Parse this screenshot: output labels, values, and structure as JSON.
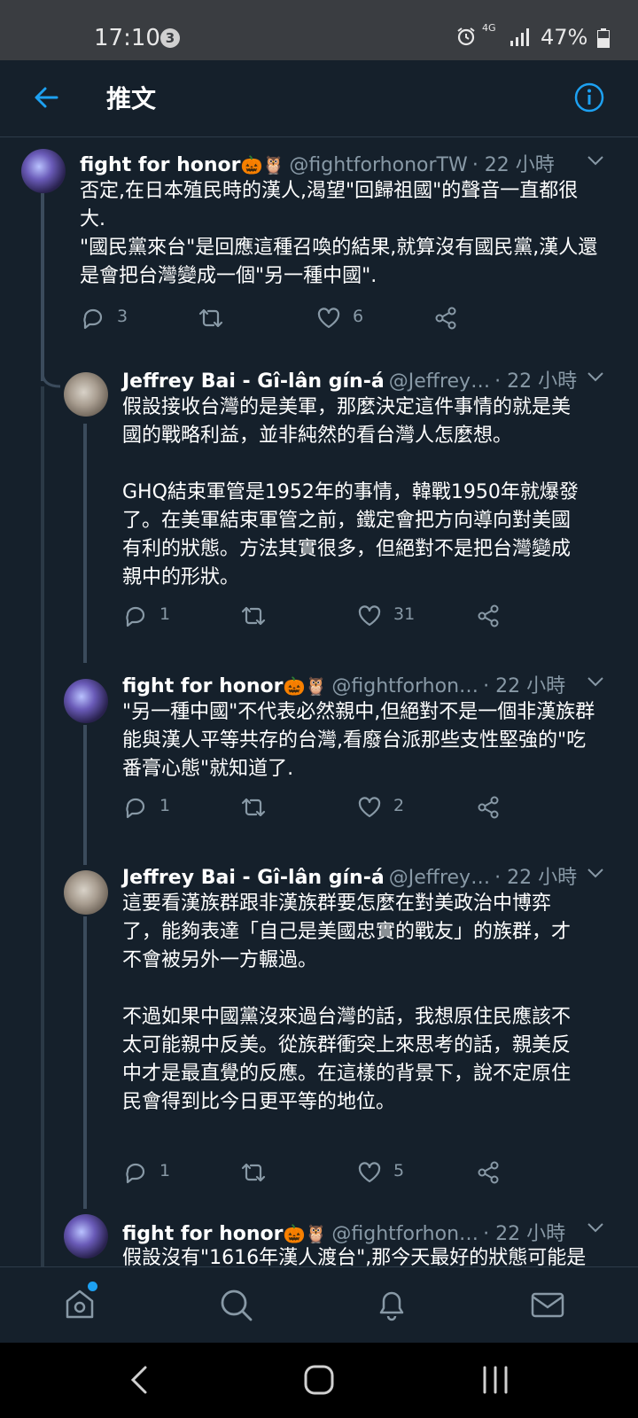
{
  "status_bar": {
    "time": "17:10",
    "notification_count": "3",
    "network": "4G",
    "battery": "47%"
  },
  "header": {
    "title": "推文",
    "back_icon": "arrow-left-icon",
    "info_icon": "info-icon"
  },
  "tweets": [
    {
      "name": "fight for honor",
      "emojis": "🎃🦉",
      "handle": "@fightforhonorTW",
      "time": "· 22 小時",
      "text": "否定,在日本殖民時的漢人,渴望\"回歸祖國\"的聲音一直都很\n大.\n\"國民黨來台\"是回應這種召喚的結果,就算沒有國民黨,漢人還\n是會把台灣變成一個\"另一種中國\".",
      "replies": "3",
      "retweets": "",
      "likes": "6"
    },
    {
      "name": "Jeffrey Bai - Gî-lân gín-á",
      "emojis": "",
      "handle": "@Jeffrey…",
      "time": "· 22 小時",
      "text": "假設接收台灣的是美軍，那麼決定這件事情的就是美\n國的戰略利益，並非純然的看台灣人怎麼想。\n\nGHQ結束軍管是1952年的事情，韓戰1950年就爆發\n了。在美軍結束軍管之前，鐵定會把方向導向對美國\n有利的狀態。方法其實很多，但絕對不是把台灣變成\n親中的形狀。",
      "replies": "1",
      "retweets": "",
      "likes": "31"
    },
    {
      "name": "fight for honor",
      "emojis": "🎃🦉",
      "handle": "@fightforhon…",
      "time": "· 22 小時",
      "text": "\"另一種中國\"不代表必然親中,但絕對不是一個非漢族群\n能與漢人平等共存的台灣,看廢台派那些支性堅強的\"吃\n番膏心態\"就知道了.",
      "replies": "1",
      "retweets": "",
      "likes": "2"
    },
    {
      "name": "Jeffrey Bai - Gî-lân gín-á",
      "emojis": "",
      "handle": "@Jeffrey…",
      "time": "· 22 小時",
      "text": "這要看漢族群跟非漢族群要怎麼在對美政治中博弈\n了，能夠表達「自己是美國忠實的戰友」的族群，才\n不會被另外一方輾過。\n\n不過如果中國黨沒來過台灣的話，我想原住民應該不\n太可能親中反美。從族群衝突上來思考的話，親美反\n中才是最直覺的反應。在這樣的背景下，說不定原住\n民會得到比今日更平等的地位。",
      "replies": "1",
      "retweets": "",
      "likes": "5"
    },
    {
      "name": "fight for honor",
      "emojis": "🎃🦉",
      "handle": "@fightforhon…",
      "time": "· 22 小時",
      "text": "假設沒有\"1616年漢人渡台\",那今天最好的狀態可能是"
    }
  ],
  "bottom_nav": {
    "items": [
      "home-icon",
      "search-icon",
      "bell-icon",
      "mail-icon"
    ]
  },
  "system_nav": {
    "items": [
      "back-chevron-icon",
      "home-circle-icon",
      "recents-icon"
    ]
  },
  "colors": {
    "background": "#15202b",
    "accent": "#1da1f2",
    "secondary_text": "#8899a6",
    "thread_line": "#3b4b5c"
  }
}
